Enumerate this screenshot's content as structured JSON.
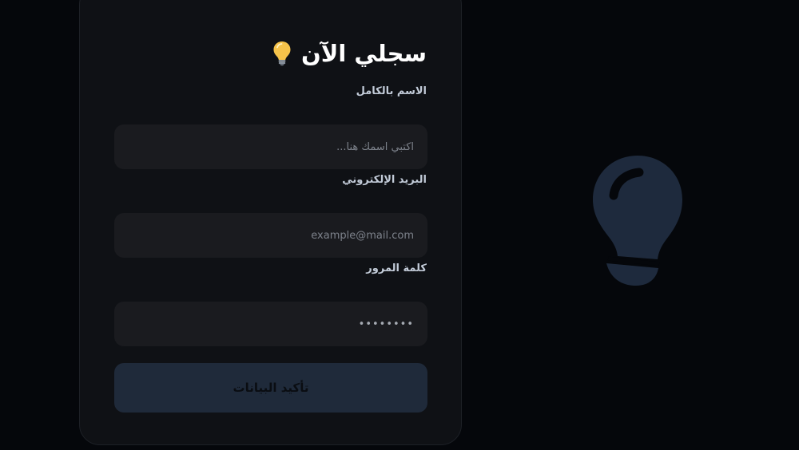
{
  "form": {
    "title": "سجلي الآن",
    "title_icon": "lightbulb-icon",
    "fields": [
      {
        "label": "الاسم بالكامل",
        "placeholder": "اكتبي اسمك هنا..."
      },
      {
        "label": "البريد الإلكتروني",
        "placeholder": "example@mail.com"
      },
      {
        "label": "كلمة المرور",
        "placeholder": "••••••••"
      }
    ],
    "submit_label": "تأكيد البيانات"
  },
  "decoration": {
    "icon": "lightbulb-icon",
    "color": "#1e2a3d"
  },
  "colors": {
    "background": "#05070b",
    "card": "#0f1115",
    "input": "#1a1b1f",
    "button": "#1f2a3a"
  }
}
